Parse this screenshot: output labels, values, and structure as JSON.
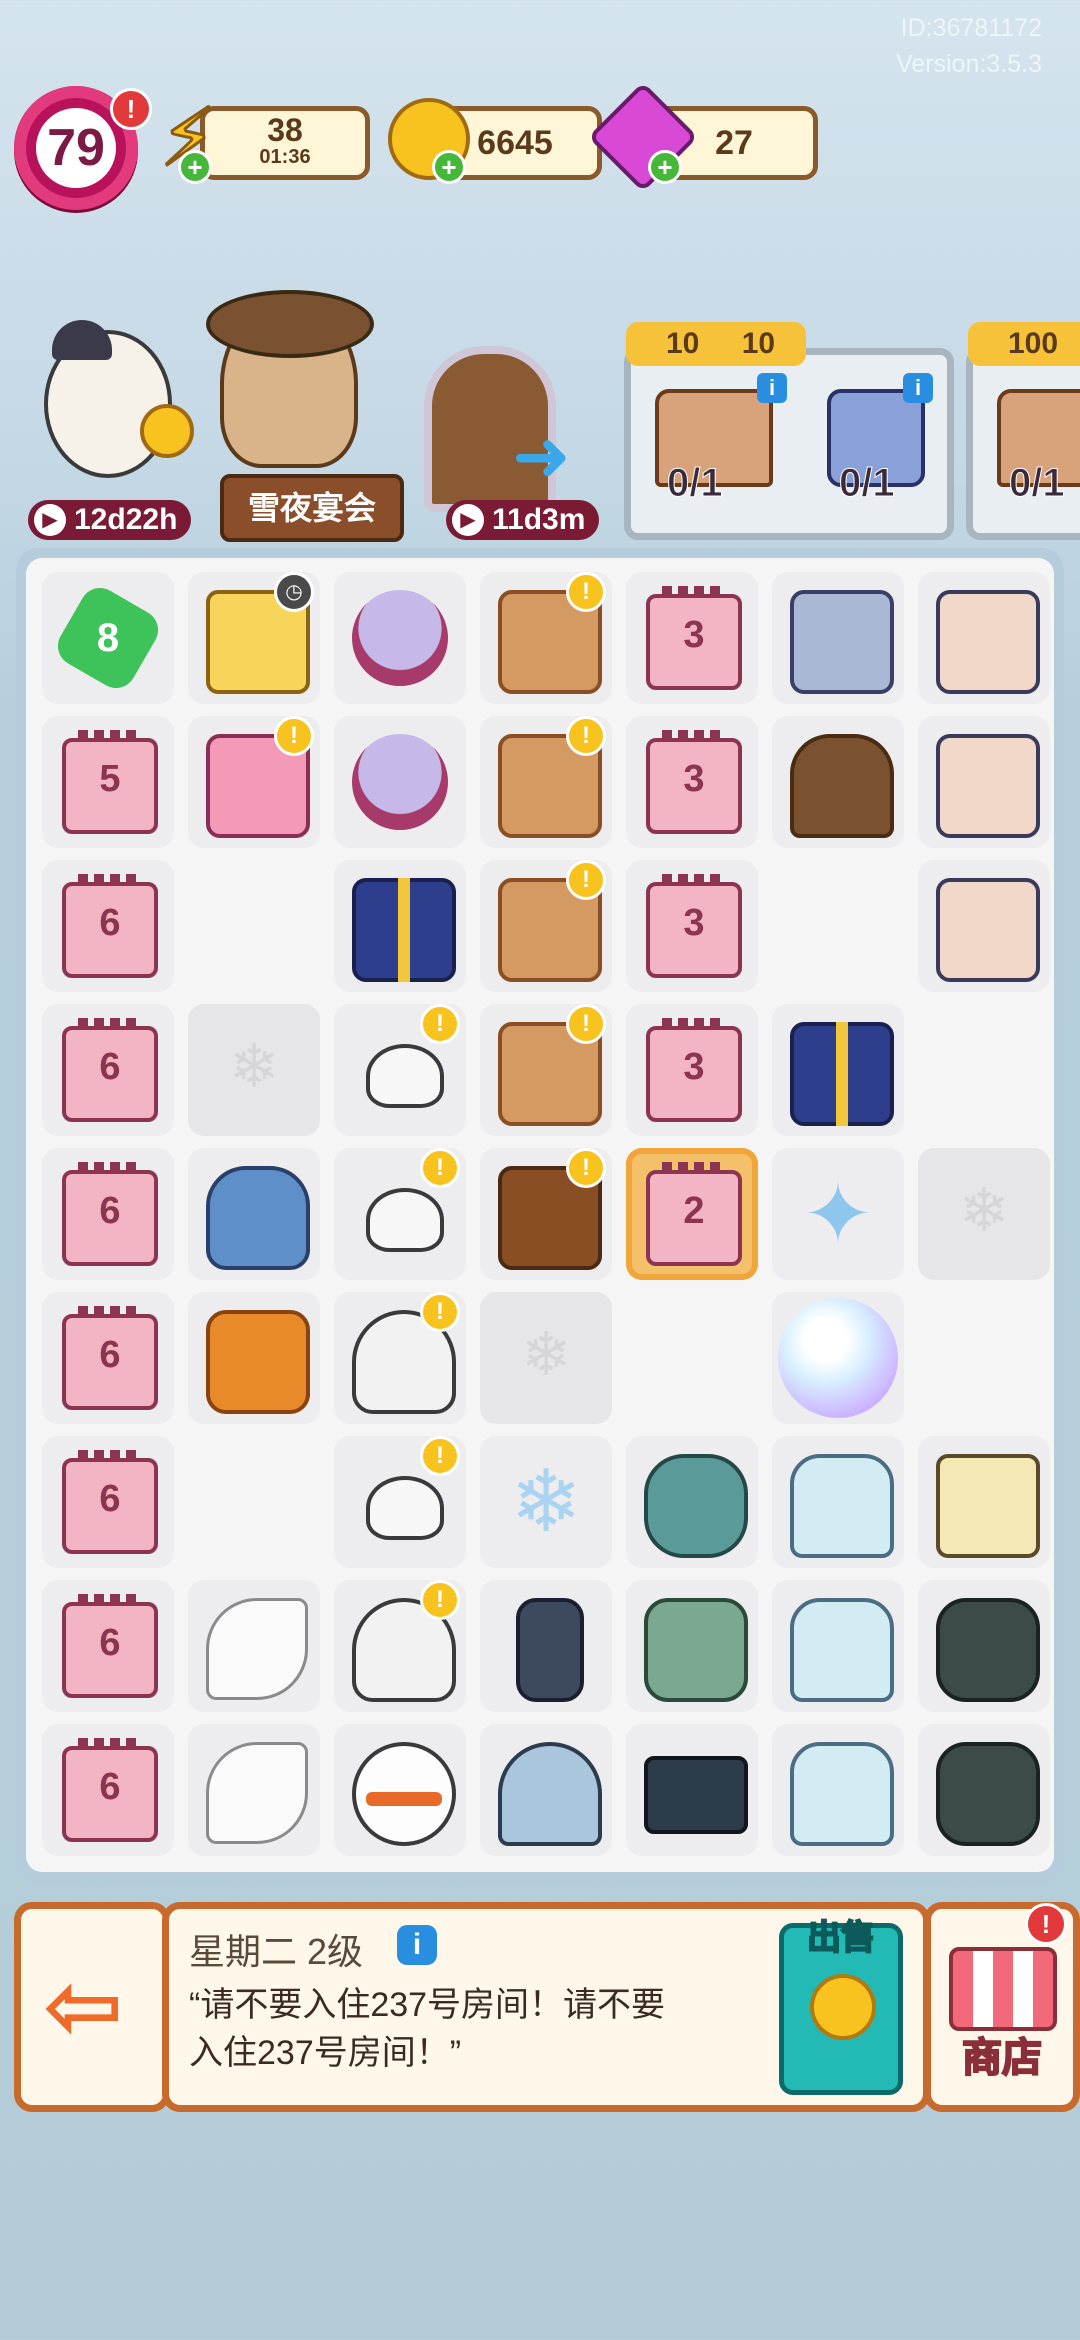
{
  "meta": {
    "id_text": "ID:36781172",
    "version_text": "Version:3.5.3"
  },
  "header": {
    "level": "79",
    "energy": {
      "value": "38",
      "timer": "01:36"
    },
    "coins": "6645",
    "gems": "27",
    "alert_symbol": "!"
  },
  "events": {
    "duck_timer": "12d22h",
    "feast_label": "雪夜宴会",
    "door_timer": "11d3m"
  },
  "orders": [
    {
      "cost_a": "10",
      "cost_b": "10",
      "progress_1": "0/1",
      "progress_2": "0/1"
    },
    {
      "cost_a": "100",
      "progress_1": "0/1"
    }
  ],
  "board": {
    "rows": [
      [
        {
          "t": "gem",
          "n": "8"
        },
        {
          "t": "tissue",
          "b": "clock"
        },
        {
          "t": "globe"
        },
        {
          "t": "cookie",
          "b": "exc"
        },
        {
          "t": "cal",
          "n": "3"
        },
        {
          "t": "house"
        },
        {
          "t": "jacket"
        }
      ],
      [
        {
          "t": "cal",
          "n": "5"
        },
        {
          "t": "sewing",
          "b": "exc"
        },
        {
          "t": "globe"
        },
        {
          "t": "cookie",
          "b": "exc"
        },
        {
          "t": "cal",
          "n": "3"
        },
        {
          "t": "door"
        },
        {
          "t": "jacket"
        }
      ],
      [
        {
          "t": "cal",
          "n": "6"
        },
        {
          "t": "empty"
        },
        {
          "t": "gift"
        },
        {
          "t": "cookie",
          "b": "exc"
        },
        {
          "t": "cal",
          "n": "3"
        },
        {
          "t": "empty"
        },
        {
          "t": "jacket"
        }
      ],
      [
        {
          "t": "cal",
          "n": "6"
        },
        {
          "t": "locked"
        },
        {
          "t": "snowball",
          "b": "exc"
        },
        {
          "t": "cookie",
          "b": "exc"
        },
        {
          "t": "cal",
          "n": "3"
        },
        {
          "t": "gift"
        },
        {
          "t": "empty"
        }
      ],
      [
        {
          "t": "cal",
          "n": "6"
        },
        {
          "t": "mitten"
        },
        {
          "t": "snowball",
          "b": "exc"
        },
        {
          "t": "gingerhouse",
          "b": "exc"
        },
        {
          "t": "cal",
          "n": "2",
          "sel": true
        },
        {
          "t": "snowflake"
        },
        {
          "t": "locked"
        }
      ],
      [
        {
          "t": "cal",
          "n": "6"
        },
        {
          "t": "jar"
        },
        {
          "t": "hat",
          "b": "exc"
        },
        {
          "t": "locked"
        },
        {
          "t": "empty"
        },
        {
          "t": "bubble"
        },
        {
          "t": "empty"
        }
      ],
      [
        {
          "t": "cal",
          "n": "6"
        },
        {
          "t": "empty"
        },
        {
          "t": "snowball",
          "b": "exc"
        },
        {
          "t": "flower"
        },
        {
          "t": "phone"
        },
        {
          "t": "statue"
        },
        {
          "t": "candle"
        }
      ],
      [
        {
          "t": "cal",
          "n": "6"
        },
        {
          "t": "feather"
        },
        {
          "t": "hat",
          "b": "exc"
        },
        {
          "t": "deadtree"
        },
        {
          "t": "valve"
        },
        {
          "t": "statue"
        },
        {
          "t": "lamp"
        }
      ],
      [
        {
          "t": "cal",
          "n": "6"
        },
        {
          "t": "feather"
        },
        {
          "t": "snowman"
        },
        {
          "t": "tree"
        },
        {
          "t": "tablet"
        },
        {
          "t": "statue"
        },
        {
          "t": "lamp"
        }
      ]
    ]
  },
  "panel": {
    "exit_symbol": "⇦",
    "item_title": "星期二 2级",
    "info_symbol": "i",
    "item_desc": "“请不要入住237号房间！请不要入住237号房间！”",
    "sell_label": "出售",
    "shop_label": "商店"
  },
  "colors": {
    "accent_pink": "#e23a7c",
    "panel_border": "#c86a2e",
    "sell_teal": "#23b9b5"
  }
}
